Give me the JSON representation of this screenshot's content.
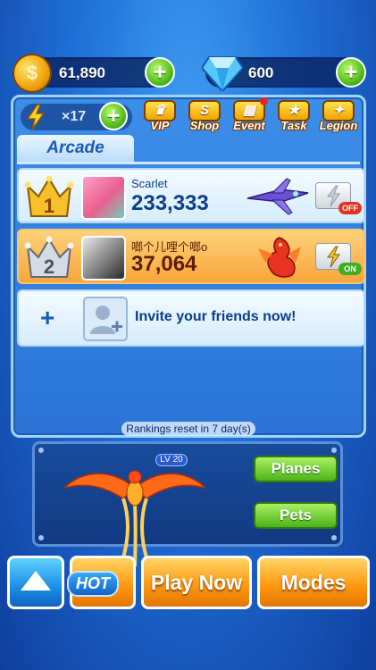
{
  "top_bar": {
    "coins": {
      "icon": "coin-icon",
      "value": "61,890"
    },
    "gems": {
      "icon": "diamond-icon",
      "value": "600"
    }
  },
  "energy": {
    "icon": "lightning-icon",
    "count": "×17"
  },
  "menu": [
    {
      "label": "VIP",
      "icon": "vip-icon"
    },
    {
      "label": "Shop",
      "icon": "shop-icon"
    },
    {
      "label": "Event",
      "icon": "event-icon"
    },
    {
      "label": "Task",
      "icon": "task-icon"
    },
    {
      "label": "Legion",
      "icon": "legion-icon"
    }
  ],
  "tab": {
    "label": "Arcade"
  },
  "rankings": [
    {
      "rank": "1",
      "name": "Scarlet",
      "score": "233,333",
      "toggle": "OFF"
    },
    {
      "rank": "2",
      "name": "啷个儿哩个啷o",
      "score": "37,064",
      "toggle": "ON"
    }
  ],
  "invite": {
    "label": "Invite your friends now!"
  },
  "reset_note": "Rankings reset in 7 day(s)",
  "pet": {
    "level": "LV 20"
  },
  "side_buttons": {
    "planes": "Planes",
    "pets": "Pets"
  },
  "bottom": {
    "hot": "HOT",
    "play": "Play Now",
    "modes": "Modes"
  },
  "colors": {
    "accent_green": "#46b213",
    "accent_orange": "#ff9a12",
    "panel_blue": "#2b74d6"
  }
}
